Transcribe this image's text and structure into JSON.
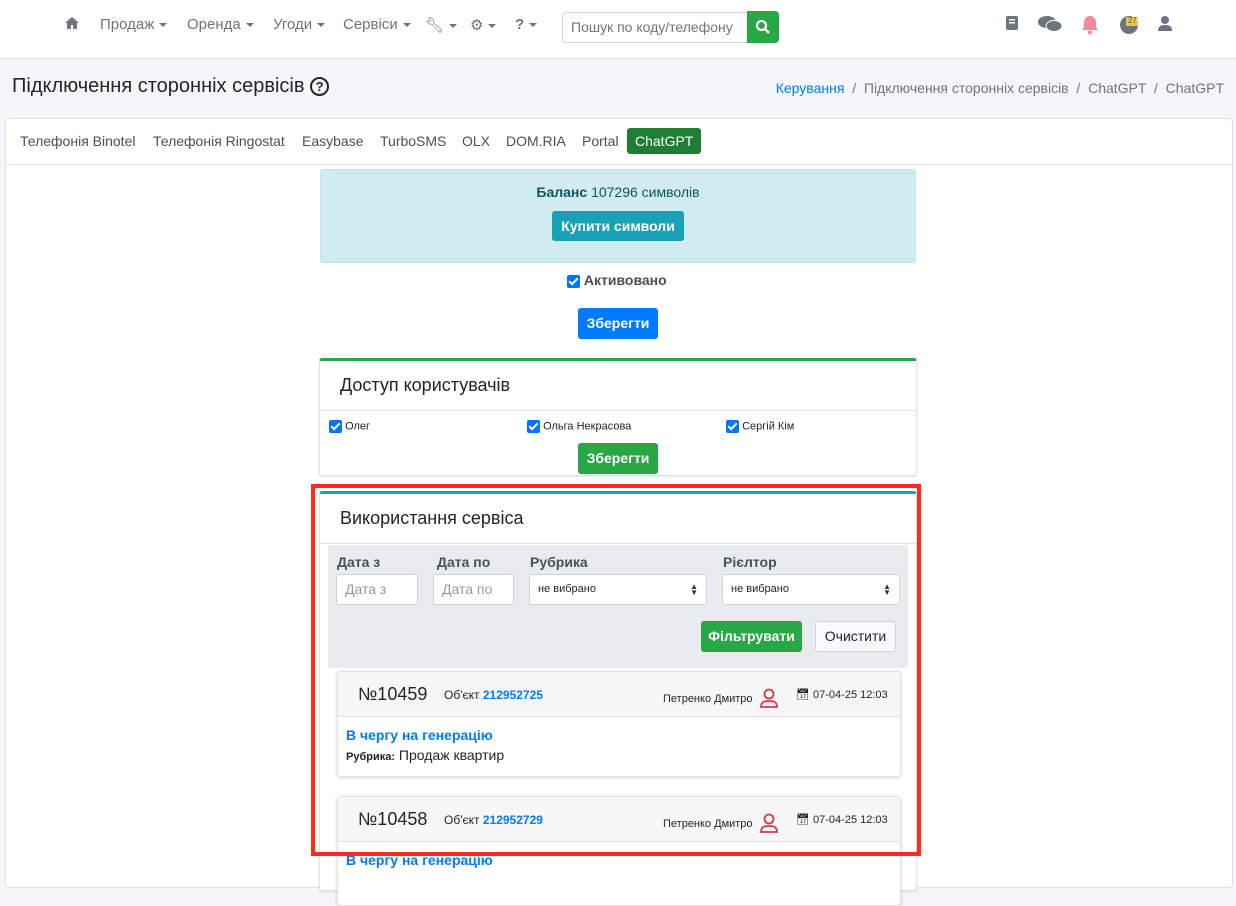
{
  "nav": {
    "items": [
      "Продаж",
      "Оренда",
      "Угоди",
      "Сервіси"
    ],
    "search_placeholder": "Пошук по коду/телефону",
    "badge": "27"
  },
  "page": {
    "title": "Підключення сторонніх сервісів",
    "breadcrumb": [
      "Керування",
      "Підключення сторонніх сервісів",
      "ChatGPT",
      "ChatGPT"
    ]
  },
  "tabs": [
    "Телефонія Binotel",
    "Телефонія Ringostat",
    "Easybase",
    "TurboSMS",
    "OLX",
    "DOM.RIA",
    "Portal",
    "ChatGPT"
  ],
  "balance": {
    "label": "Баланс",
    "value": "107296 символів",
    "buy": "Купити символи"
  },
  "activated": "Активовано",
  "save": "Зберегти",
  "access": {
    "title": "Доступ користувачів",
    "users": [
      "Олег",
      "Ольга Некрасова",
      "Сергій Кім"
    ],
    "save": "Зберегти"
  },
  "usage": {
    "title": "Використання сервіса",
    "date_from": "Дата з",
    "date_to": "Дата по",
    "rubric": "Рубрика",
    "realtor": "Рієлтор",
    "not_selected": "не вибрано",
    "filter": "Фільтрувати",
    "clear": "Очистити",
    "entries": [
      {
        "num": "№10459",
        "obj_label": "Об'єкт",
        "obj": "212952725",
        "user": "Петренко Дмитро",
        "date": "07-04-25 12:03",
        "status": "В чергу на генерацію",
        "rubric_label": "Рубрика:",
        "rubric": "Продаж квартир"
      },
      {
        "num": "№10458",
        "obj_label": "Об'єкт",
        "obj": "212952729",
        "user": "Петренко Дмитро",
        "date": "07-04-25 12:03",
        "status": "В чергу на генерацію"
      }
    ]
  }
}
